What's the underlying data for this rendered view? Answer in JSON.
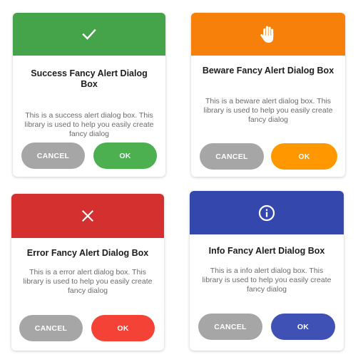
{
  "dialogs": {
    "success": {
      "title": "Success Fancy Alert Dialog Box",
      "message": "This is a success alert dialog box. This library is used to help you easily create fancy dialog",
      "icon": "check-icon",
      "color": "#45a349",
      "cancel_label": "CANCEL",
      "ok_label": "OK",
      "ok_color": "#4caf50"
    },
    "beware": {
      "title": "Beware Fancy Alert Dialog Box",
      "message": "This is a beware alert dialog box. This library is used to help you easily create fancy dialog",
      "icon": "hand-icon",
      "color": "#f7800b",
      "cancel_label": "CANCEL",
      "ok_label": "OK",
      "ok_color": "#ff9800"
    },
    "error": {
      "title": "Error Fancy Alert Dialog Box",
      "message": "This is a error alert dialog box. This library is used to help you easily create fancy dialog",
      "icon": "close-icon",
      "color": "#d4302f",
      "cancel_label": "CANCEL",
      "ok_label": "OK",
      "ok_color": "#f44336"
    },
    "info": {
      "title": "Info Fancy Alert Dialog Box",
      "message": "This is a info alert dialog box. This library is used to help you easily create fancy dialog",
      "icon": "info-icon",
      "color": "#3347ad",
      "cancel_label": "CANCEL",
      "ok_label": "OK",
      "ok_color": "#3f51b5"
    }
  }
}
